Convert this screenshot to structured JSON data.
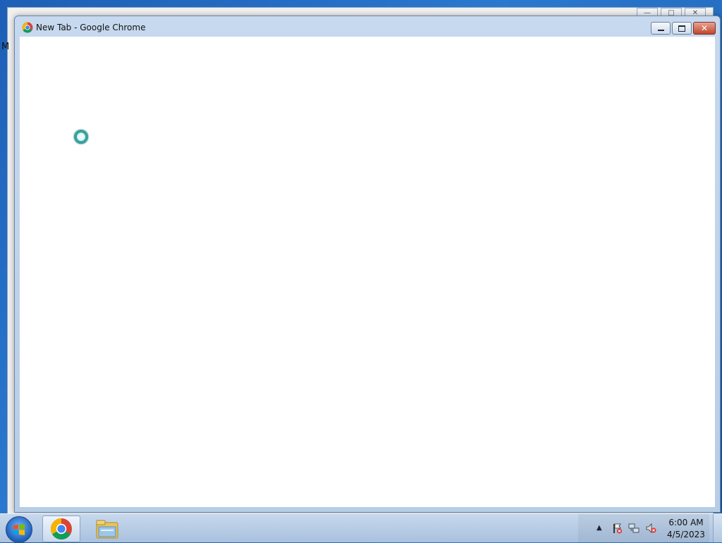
{
  "background_window": {
    "stray_letter": "M",
    "controls": {
      "min": "—",
      "max": "□",
      "close": "✕"
    }
  },
  "window": {
    "title": "New Tab - Google Chrome",
    "controls": {
      "minimize": "minimize",
      "maximize": "maximize",
      "close": "✕"
    }
  },
  "taskbar": {
    "items": [
      "start-orb-icon",
      "chrome-icon",
      "file-explorer-icon"
    ],
    "tray_icons": [
      "show-hidden-icons-icon",
      "action-center-icon",
      "network-icon",
      "volume-muted-icon"
    ],
    "clock": {
      "time": "6:00 AM",
      "date": "4/5/2023"
    }
  }
}
